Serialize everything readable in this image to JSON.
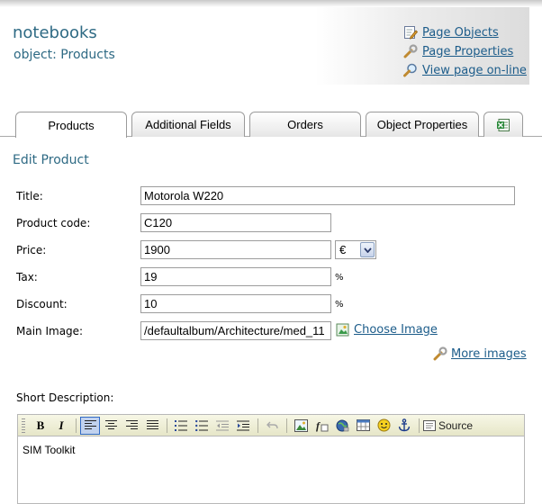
{
  "header": {
    "site_name": "notebooks",
    "object_line": "object: Products",
    "links": [
      {
        "label": "Page Objects",
        "icon": "edit-page-icon"
      },
      {
        "label": "Page Properties",
        "icon": "wrench-icon"
      },
      {
        "label": "View page on-line",
        "icon": "magnifier-icon"
      }
    ]
  },
  "tabs": [
    {
      "label": "Products",
      "active": true
    },
    {
      "label": "Additional Fields"
    },
    {
      "label": "Orders"
    },
    {
      "label": "Object Properties"
    },
    {
      "label": "",
      "icon": "excel-icon"
    }
  ],
  "section_title": "Edit Product",
  "form": {
    "title_label": "Title:",
    "title_value": "Motorola W220",
    "code_label": "Product code:",
    "code_value": "C120",
    "price_label": "Price:",
    "price_value": "1900",
    "currency": "€",
    "tax_label": "Tax:",
    "tax_value": "19",
    "tax_unit": "%",
    "discount_label": "Discount:",
    "discount_value": "10",
    "discount_unit": "%",
    "image_label": "Main Image:",
    "image_value": "/defaultalbum/Architecture/med_11",
    "choose_image": "Choose Image",
    "more_images": "More images"
  },
  "short_description": {
    "label": "Short Description:",
    "toolbar_source": "Source",
    "content": "SIM Toolkit"
  },
  "colors": {
    "heading": "#2e6a84",
    "link": "#1c5c8a",
    "toolbar_bg": "#ecebd0"
  }
}
